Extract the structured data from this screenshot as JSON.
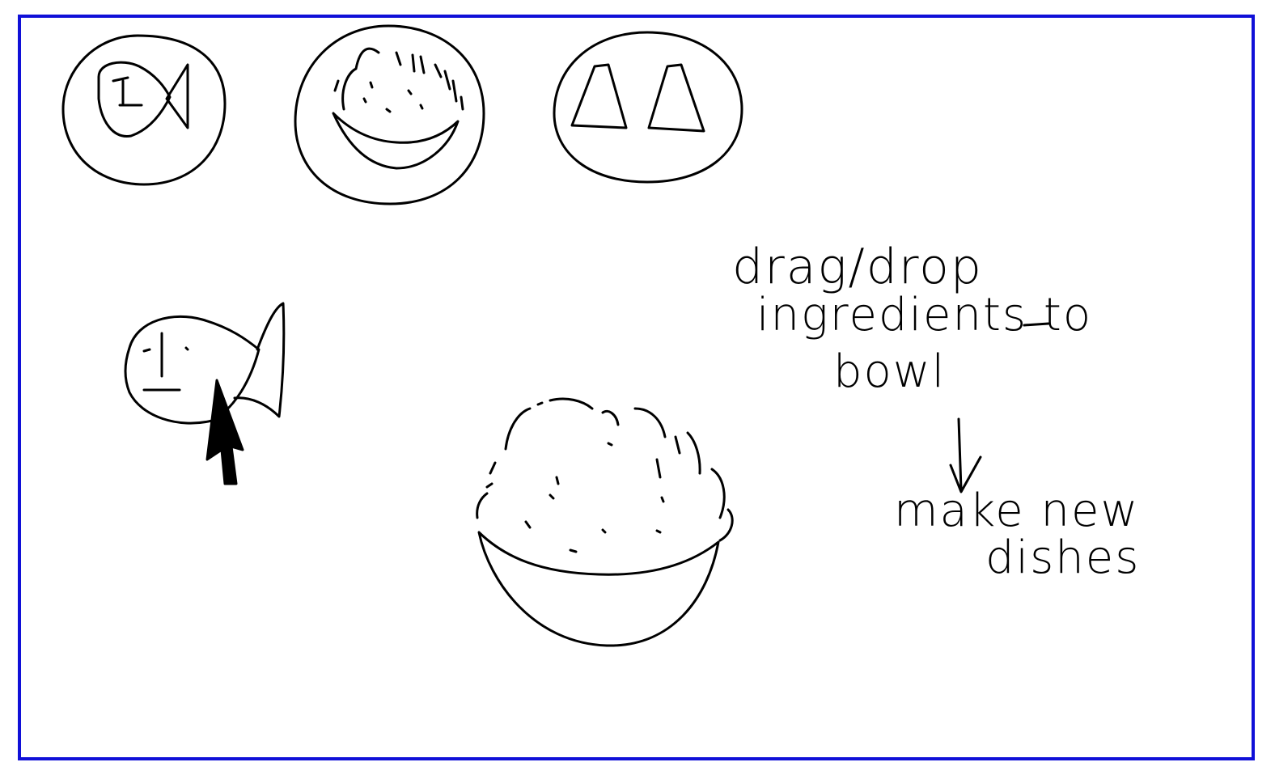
{
  "frame_color": "#1010d8",
  "ingredients": [
    {
      "icon": "fish-icon"
    },
    {
      "icon": "rice-bowl-icon"
    },
    {
      "icon": "salt-pepper-shakers-icon"
    }
  ],
  "dragged_item": {
    "icon": "fish-icon",
    "cursor": "mouse-pointer-icon"
  },
  "target": {
    "icon": "rice-bowl-icon"
  },
  "instruction": {
    "line1": "drag/drop",
    "line2": "ingredients to",
    "line3": "bowl"
  },
  "result": {
    "line1": "make new",
    "line2": "dishes"
  }
}
